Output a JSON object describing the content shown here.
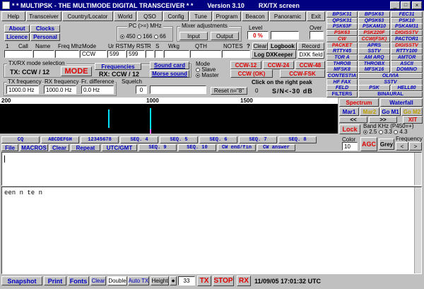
{
  "title": "* * MULTIPSK - THE MULTIMODE DIGITAL TRANSCEIVER * *",
  "version": "Version 3.10",
  "screen": "RX/TX screen",
  "menu": [
    "Help",
    "Transceiver",
    "Country/Locator",
    "World",
    "QSO",
    "Config",
    "Tune",
    "Program",
    "Beacon",
    "Panoramic",
    "Exit"
  ],
  "row2": {
    "about": "About",
    "clocks": "Clocks",
    "licence": "Licence",
    "personal": "Personal"
  },
  "pc": {
    "label": "PC (>=) MHz",
    "opts": [
      "450",
      "166",
      "66"
    ]
  },
  "mixer": {
    "label": "Mixer adjustments",
    "input": "Input",
    "output": "Output"
  },
  "level": {
    "label": "Level",
    "value": "0 %",
    "over": "Over"
  },
  "qso_headers": [
    "Call",
    "Name",
    "Freq Mhz",
    "Mode",
    "Ur RST",
    "My RST",
    "R",
    "S",
    "Wkg",
    "QTH",
    "NOTES"
  ],
  "qso_values": {
    "index": "1",
    "mode": "CCW",
    "ur_rst": "599",
    "my_rst": "599",
    "q": "?"
  },
  "log": {
    "clear": "Clear",
    "logbook": "Logbook",
    "record": "Record",
    "dxkeeper": "Log DXKeeper",
    "dxk_field": "DXK field"
  },
  "txrx": {
    "label": "TX/RX mode selection",
    "tx": "TX: CCW / 12",
    "mode": "MODE",
    "frequencies": "Frequencies",
    "rx": "RX: CCW / 12",
    "sound_card": "Sound card",
    "morse": "Morse sound",
    "mode_opt": "Mode",
    "slave": "Slave",
    "master": "Master"
  },
  "ccw": {
    "ccw12": "CCW-12",
    "ccw24": "CCW-24",
    "ccw48": "CCW-48",
    "ccwok": "CCW (OK)",
    "ccwfsk": "CCW-FSK"
  },
  "freq": {
    "tx_label": "TX frequency",
    "tx": "1000.0 Hz",
    "rx_label": "RX frequency",
    "rx": "1000.0 Hz",
    "diff_label": "Fr. difference",
    "diff": "0.0 Hz",
    "squelch": "Squelch",
    "squelch_val": "0",
    "reset": "Reset n=\"8\"",
    "click": "Click on the right peak",
    "sn": "S/N<-30 dB"
  },
  "modes": [
    [
      "BPSK31",
      "BPSK63",
      "FEC31"
    ],
    [
      "QPSK31",
      "QPSK63",
      "PSK10"
    ],
    [
      "PSK63F",
      "PSKAM10",
      "PSKAM31"
    ],
    [
      "PSK63",
      "PSK220F",
      "DIGISSTV"
    ],
    [
      "CW",
      "CCW(FSK)",
      "PACTOR1"
    ],
    [
      "PACKET",
      "APRS",
      "DIGISSTV"
    ],
    [
      "RTTY45",
      "SSTV",
      "RTTY100"
    ],
    [
      "TOR A",
      "AM ARQ",
      "AMTOR"
    ],
    [
      "THROB",
      "THROBX",
      "ASCII"
    ],
    [
      "MFSK8",
      "MFSK16",
      "DOMINO"
    ],
    [
      "CONTESTIA",
      "OLIVIA",
      ""
    ],
    [
      "HF FAX",
      "SSTV",
      ""
    ],
    [
      "FELD",
      "PSK",
      "HELL80"
    ],
    [
      "FILTERS",
      "BINAURAL",
      ""
    ]
  ],
  "spectrum": {
    "ticks": [
      "200",
      "1000",
      "1500"
    ],
    "spectrum": "Spectrum",
    "waterfall": "Waterfall",
    "mar1": "Mar1",
    "mar2": "Mar2",
    "gom1": "Go M1",
    "gom2": "Go M2",
    "xit": "XIT",
    "lock": "Lock",
    "band": "Band KHz (P450=+)",
    "b1": "2.5",
    "b2": "3.3",
    "b3": "4.3",
    "color": "Color",
    "color_val": "10",
    "agc": "AGC",
    "grey": "Grey",
    "frequency": "Frequency"
  },
  "macros_row1": [
    "CQ",
    "ABCDEFGH",
    "12345678",
    "SEQ. 4",
    "SEQ. 5",
    "SEQ. 6",
    "SEQ. 7",
    "SEQ. 8"
  ],
  "macros_row2": [
    "File",
    "MACROS",
    "Clear",
    "Repeat",
    "UTC/GMT",
    "SEQ. 9",
    "SEQ. 10",
    "CW end/fin",
    "CW answer"
  ],
  "rx_text": "een  n te  n",
  "bottom": {
    "snapshot": "Snapshot",
    "print": "Print",
    "fonts": "Fonts",
    "clear": "Clear",
    "double": "Double",
    "autotx": "Auto TX",
    "height": "Height",
    "height_val": "33",
    "tx": "TX",
    "stop": "STOP",
    "rx": "RX",
    "datetime": "11/09/05 17:01:32 UTC"
  },
  "colors": {
    "title_bar": "#000080",
    "spectrum_bg": "#000000",
    "waterfall_line": "#00e0ff",
    "red_text": "#e00000",
    "blue_text": "#0000c0"
  }
}
